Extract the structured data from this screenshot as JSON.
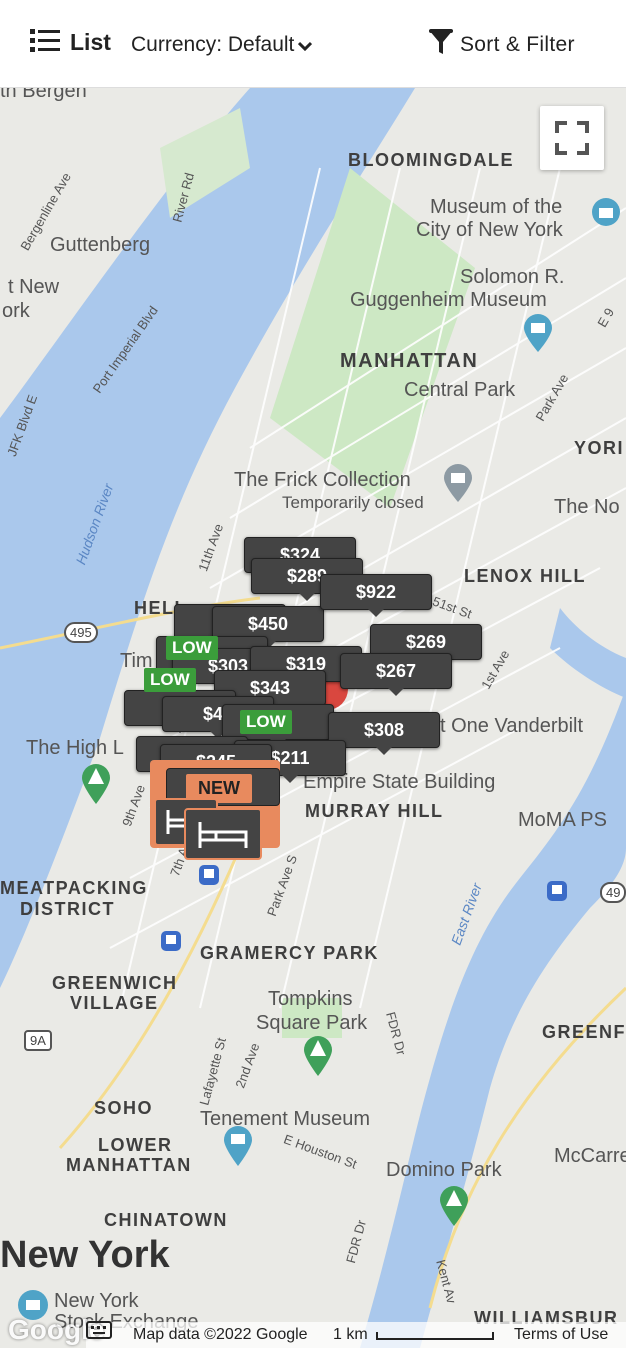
{
  "header": {
    "list_label": "List",
    "currency_label": "Currency: Default",
    "sort_filter_label": "Sort & Filter"
  },
  "map": {
    "labels": {
      "bergen": "th Bergen",
      "guttenberg": "Guttenberg",
      "west_new_york_1": "t New",
      "west_new_york_2": "ork",
      "bloomingdale": "BLOOMINGDALE",
      "museum_1": "Museum of the",
      "museum_2": "City of New York",
      "guggenheim_1": "Solomon R.",
      "guggenheim_2": "Guggenheim Museum",
      "manhattan": "MANHATTAN",
      "central_park": "Central Park",
      "york": "YORI",
      "frick": "The Frick Collection",
      "frick_status": "Temporarily closed",
      "the_no": "The No",
      "lenox_hill": "LENOX HILL",
      "hells_kitchen": "HELL",
      "times": "Tim",
      "one_vanderbilt": "t One Vanderbilt",
      "high_line": "The High L",
      "empire": "Empire State Building",
      "murray_hill": "MURRAY HILL",
      "moma": "MoMA PS",
      "meatpacking_1": "MEATPACKING",
      "meatpacking_2": "DISTRICT",
      "gramercy": "GRAMERCY PARK",
      "greenwich_1": "GREENWICH",
      "greenwich_2": "VILLAGE",
      "tompkins_1": "Tompkins",
      "tompkins_2": "Square Park",
      "greenpoint": "GREENF",
      "soho": "SOHO",
      "lower_manhattan_1": "LOWER",
      "lower_manhattan_2": "MANHATTAN",
      "tenement": "Tenement Museum",
      "domino": "Domino Park",
      "mccarren": "McCarren",
      "chinatown": "CHINATOWN",
      "new_york": "New York",
      "ny_exchange_1": "New York",
      "ny_exchange_2": "Stock Exchange",
      "williamsburg": "WILLIAMSBUR",
      "hudson_river": "Hudson River",
      "east_river": "East River",
      "bergenline": "Bergenline Ave",
      "river_rd": "River Rd",
      "port_imperial": "Port Imperial Blvd",
      "jfk": "JFK Blvd E",
      "eleventh_ave": "11th Ave",
      "ninth_ave": "9th Ave",
      "seventh_ave": "7th Ave",
      "park_ave_s": "Park Ave S",
      "park_ave": "Park Ave",
      "first_ave": "1st Ave",
      "e_ninth": "E 9",
      "e51": "51st St",
      "lafayette": "Lafayette St",
      "second_ave": "2nd Ave",
      "e_houston": "E Houston St",
      "fdr": "FDR Dr",
      "fdr2": "FDR Dr",
      "kent": "Kent Av",
      "route_495": "495",
      "route_9a": "9A",
      "route_49": "49"
    },
    "price_pins": [
      "$324",
      "$289",
      "$922",
      "$450",
      "$269",
      "$303",
      "$319",
      "$267",
      "$343",
      "$42",
      "$4",
      "$308",
      "$211",
      "$245"
    ],
    "low_tags": [
      "LOW",
      "LOW",
      "LOW"
    ],
    "new_tag": "NEW",
    "footer": {
      "google": "Google",
      "map_data": "Map data ©2022 Google",
      "scale": "1 km",
      "terms": "Terms of Use"
    }
  },
  "colors": {
    "pin_bg": "#444444",
    "low_green": "#3b9d3b",
    "new_orange": "#e88a5e",
    "water": "#aac8ec",
    "park": "#cde8c4"
  }
}
